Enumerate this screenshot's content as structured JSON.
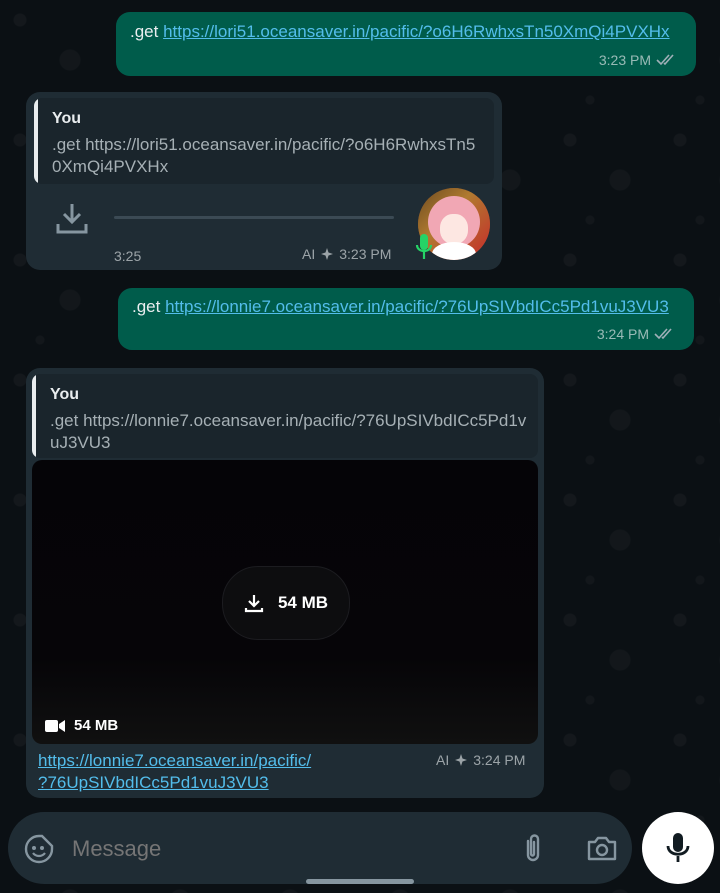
{
  "messages": [
    {
      "text_prefix": ".get",
      "link": "https://lori51.oceansaver.in/pacific/?o6H6RwhxsTn50XmQi4PVXHx",
      "time": "3:23 PM"
    },
    {
      "quote_author": "You",
      "quote_text": ".get https://lori51.oceansaver.in/pacific/?o6H6RwhxsTn50XmQi4PVXHx",
      "duration": "3:25",
      "ai_label": "AI",
      "time": "3:23 PM"
    },
    {
      "text_prefix": ".get",
      "link": "https://lonnie7.oceansaver.in/pacific/?76UpSIVbdICc5Pd1vuJ3VU3",
      "time": "3:24 PM"
    },
    {
      "quote_author": "You",
      "quote_text": ".get https://lonnie7.oceansaver.in/pacific/?76UpSIVbdICc5Pd1vuJ3VU3",
      "download_label": "54 MB",
      "video_size": "54 MB",
      "caption_link_line1": "https://lonnie7.oceansaver.in/pacific/",
      "caption_link_line2": "?76UpSIVbdICc5Pd1vuJ3VU3",
      "ai_label": "AI",
      "time": "3:24 PM"
    }
  ],
  "composer": {
    "placeholder": "Message"
  },
  "colors": {
    "outgoing_bubble": "#005c4b",
    "incoming_bubble": "#1f2c34",
    "link": "#53bdeb",
    "read_ticks": "#9fb0b8",
    "mic_green": "#25d366"
  },
  "icons": [
    "double-check-icon",
    "download-icon",
    "mic-icon",
    "ai-sparkle-icon",
    "video-icon",
    "sticker-icon",
    "attach-icon",
    "camera-icon"
  ]
}
